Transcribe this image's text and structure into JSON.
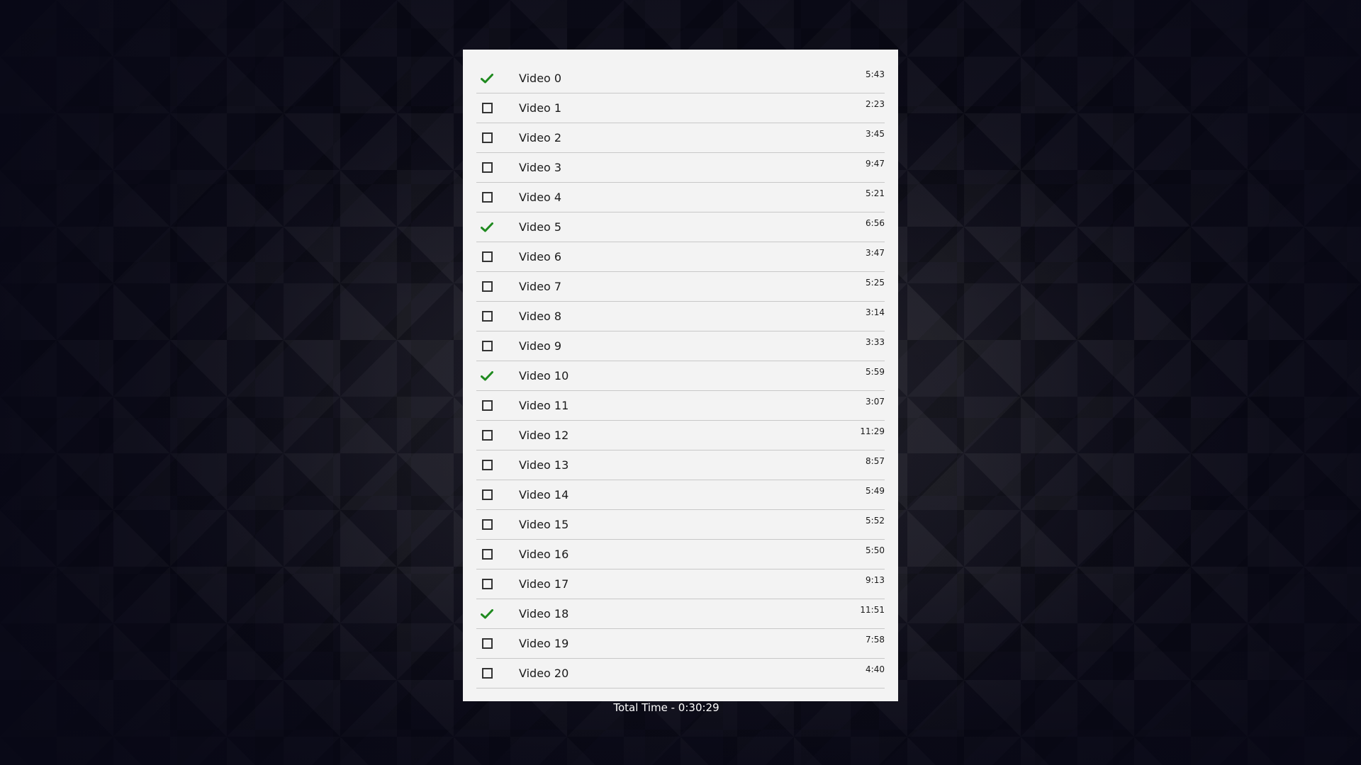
{
  "colors": {
    "check_green": "#1f8a1f",
    "panel_background": "#f3f3f3",
    "page_background": "#0d0c17"
  },
  "videos": [
    {
      "title": "Video 0",
      "duration": "5:43",
      "watched": true
    },
    {
      "title": "Video 1",
      "duration": "2:23",
      "watched": false
    },
    {
      "title": "Video 2",
      "duration": "3:45",
      "watched": false
    },
    {
      "title": "Video 3",
      "duration": "9:47",
      "watched": false
    },
    {
      "title": "Video 4",
      "duration": "5:21",
      "watched": false
    },
    {
      "title": "Video 5",
      "duration": "6:56",
      "watched": true
    },
    {
      "title": "Video 6",
      "duration": "3:47",
      "watched": false
    },
    {
      "title": "Video 7",
      "duration": "5:25",
      "watched": false
    },
    {
      "title": "Video 8",
      "duration": "3:14",
      "watched": false
    },
    {
      "title": "Video 9",
      "duration": "3:33",
      "watched": false
    },
    {
      "title": "Video 10",
      "duration": "5:59",
      "watched": true
    },
    {
      "title": "Video 11",
      "duration": "3:07",
      "watched": false
    },
    {
      "title": "Video 12",
      "duration": "11:29",
      "watched": false
    },
    {
      "title": "Video 13",
      "duration": "8:57",
      "watched": false
    },
    {
      "title": "Video 14",
      "duration": "5:49",
      "watched": false
    },
    {
      "title": "Video 15",
      "duration": "5:52",
      "watched": false
    },
    {
      "title": "Video 16",
      "duration": "5:50",
      "watched": false
    },
    {
      "title": "Video 17",
      "duration": "9:13",
      "watched": false
    },
    {
      "title": "Video 18",
      "duration": "11:51",
      "watched": true
    },
    {
      "title": "Video 19",
      "duration": "7:58",
      "watched": false
    },
    {
      "title": "Video 20",
      "duration": "4:40",
      "watched": false
    }
  ],
  "footer": {
    "total_time": "Total Time - 0:30:29"
  }
}
